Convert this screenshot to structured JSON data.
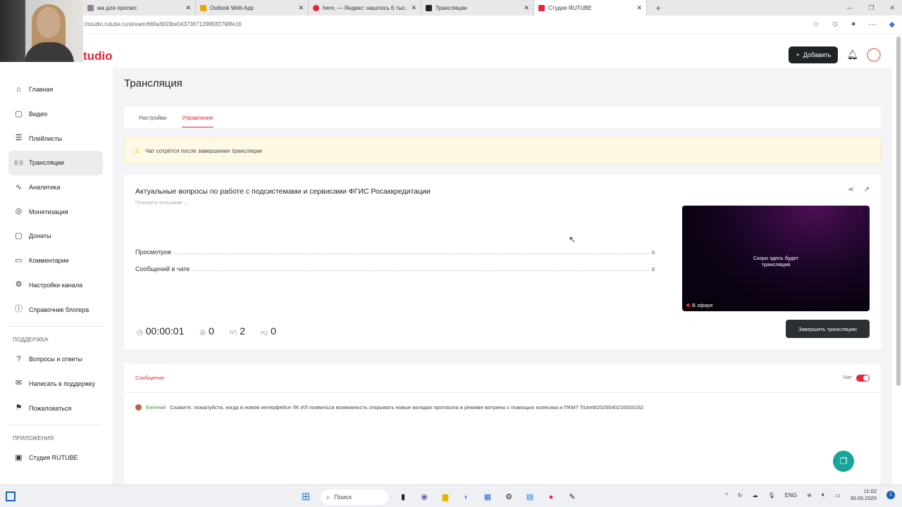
{
  "browser": {
    "tabs": [
      {
        "label": "ма для просмо:",
        "color": "#888"
      },
      {
        "label": "Outlook Web App",
        "color": "#e8a400"
      },
      {
        "label": "here, — Яндекс: нашлось 6 тыс.",
        "color": "#e8233a"
      },
      {
        "label": "Трансляции",
        "color": "#222"
      },
      {
        "label": "Студия RUTUBE",
        "color": "#e8233a",
        "active": true
      }
    ],
    "url": "://studio.rutube.ru/stream/66fad933be0437367129f80f2798fe16"
  },
  "logo": "tudio",
  "sidebar": {
    "items": [
      "Главная",
      "Видео",
      "Плейлисты",
      "Трансляции",
      "Аналитика",
      "Монетизация",
      "Донаты",
      "Комментарии",
      "Настройки канала",
      "Справочник блогера"
    ],
    "icons": [
      "⌂",
      "▢",
      "☰",
      "((·))",
      "∿",
      "◎",
      "▢",
      "▭",
      "⚙",
      "ⓘ"
    ],
    "support_title": "ПОДДЕРЖКА",
    "support": [
      "Вопросы и ответы",
      "Написать в поддержку",
      "Пожаловаться"
    ],
    "apps_title": "ПРИЛОЖЕНИЯ",
    "apps": [
      "Студия RUTUBE"
    ]
  },
  "header": {
    "add_label": "Добавить"
  },
  "page": {
    "title": "Трансляция",
    "tabs": [
      "Настройки",
      "Управление"
    ],
    "warning": "Чат сотрётся после завершения трансляции"
  },
  "stream": {
    "title": "Актуальные вопросы по работе с подсистемами и сервисами ФГИС Росаккредитации",
    "show_desc": "Показать описание ⌄",
    "stats": [
      {
        "label": "Просмотров",
        "value": "0"
      },
      {
        "label": "Сообщений в чате",
        "value": "0"
      }
    ],
    "duration": "00:00:01",
    "viewers": "0",
    "likes": "2",
    "dislikes": "0",
    "preview_text1": "Скоро здесь будет",
    "preview_text2": "трансляция",
    "live": "В эфире",
    "end_button": "Завершить трансляцию"
  },
  "chat": {
    "tab": "Сообщения",
    "toggle_label": "Чат",
    "toggle_on": true,
    "messages": [
      {
        "author": "Евгений",
        "text": "Скажите, пожалуйста, когда в новом интерфейсе ЛК ИЛ появиться возможность открывать новые вкладки протокола в режиме витрины с помощью колесика и ПКМ? Ticket#2025040210003162"
      }
    ]
  },
  "taskbar": {
    "search": "Поиск",
    "lang": "ENG",
    "time": "11:02",
    "date": "30.05.2025"
  }
}
